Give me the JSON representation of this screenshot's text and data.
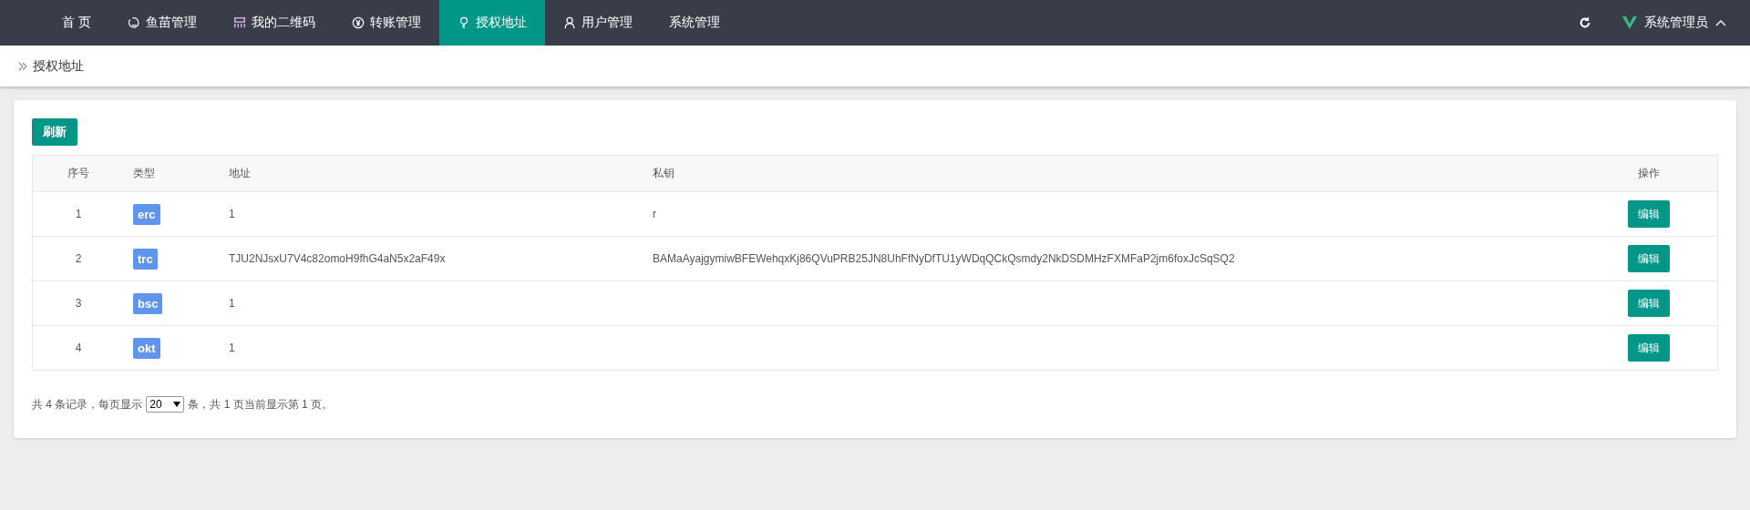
{
  "nav": {
    "items": [
      {
        "label": "首 页",
        "selected": false
      },
      {
        "label": "鱼苗管理",
        "selected": false
      },
      {
        "label": "我的二维码",
        "selected": false
      },
      {
        "label": "转账管理",
        "selected": false
      },
      {
        "label": "授权地址",
        "selected": true
      },
      {
        "label": "用户管理",
        "selected": false
      },
      {
        "label": "系统管理",
        "selected": false
      }
    ],
    "user": "系统管理员"
  },
  "breadcrumb": "授权地址",
  "refresh_button": "刷新",
  "table": {
    "columns": [
      "序号",
      "类型",
      "地址",
      "私钥",
      "操作"
    ],
    "rows": [
      {
        "index": "1",
        "type": "erc",
        "address": "1",
        "key": "r",
        "action": "编辑"
      },
      {
        "index": "2",
        "type": "trc",
        "address": "TJU2NJsxU7V4c82omoH9fhG4aN5x2aF49x",
        "key": "BAMaAyajgymiwBFEWehqxKj86QVuPRB25JN8UhFfNyDfTU1yWDqQCkQsmdy2NkDSDMHzFXMFaP2jm6foxJcSqSQ2",
        "action": "编辑"
      },
      {
        "index": "3",
        "type": "bsc",
        "address": "1",
        "action": "编辑"
      },
      {
        "index": "4",
        "type": "okt",
        "address": "1",
        "action": "编辑"
      }
    ]
  },
  "pagination": {
    "before": "共 4 条记录，每页显示",
    "page_size": "20",
    "after": "条，共 1 页当前显示第 1 页。"
  }
}
